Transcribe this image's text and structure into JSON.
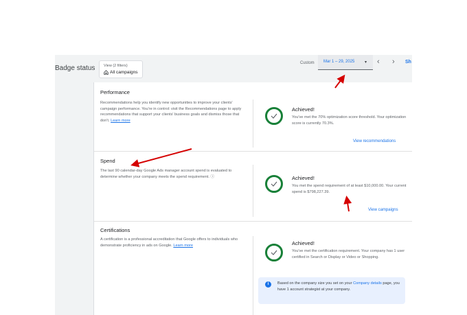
{
  "header": {
    "title": "Badge status",
    "view_filters": "View (2 filters)",
    "view_value": "All campaigns",
    "date_label": "Custom",
    "date_range": "Mar 1 – 29, 2025",
    "caret": "▾",
    "prev": "‹",
    "next": "›",
    "show_cut": "Sh"
  },
  "sections": {
    "performance": {
      "title": "Performance",
      "desc": "Recommendations help you identify new opportunities to improve your clients' campaign performance. You're in control: visit the Recommendations page to apply recommendations that support your clients' business goals and dismiss those that don't.",
      "learn": "Learn more",
      "status": "Achieved!",
      "status_desc": "You've met the 70% optimization score threshold. Your optimization score is currently 70.3%.",
      "link": "View recommendations"
    },
    "spend": {
      "title": "Spend",
      "desc": "The last 90 calendar-day Google Ads manager account spend is evaluated to determine whether your company meets the spend requirement.",
      "help": "ⓘ",
      "status": "Achieved!",
      "status_desc": "You met the spend requirement of at least $10,000.00. Your current spend is $798,227.39.",
      "link": "View campaigns"
    },
    "certifications": {
      "title": "Certifications",
      "desc": "A certification is a professional accreditation that Google offers to individuals who demonstrate proficiency in ads on Google.",
      "learn": "Learn more",
      "status": "Achieved!",
      "status_desc": "You've met the certification requirement. Your company has 1 user certified in Search or Display or Video or Shopping.",
      "info_pre": "Based on the company size you set on your",
      "info_link": "Company details",
      "info_post": "page, you have 1 account strategist at your company.",
      "info_icon": "i"
    }
  },
  "colors": {
    "success": "#188038",
    "link": "#1a73e8",
    "annotation": "#d50000"
  }
}
